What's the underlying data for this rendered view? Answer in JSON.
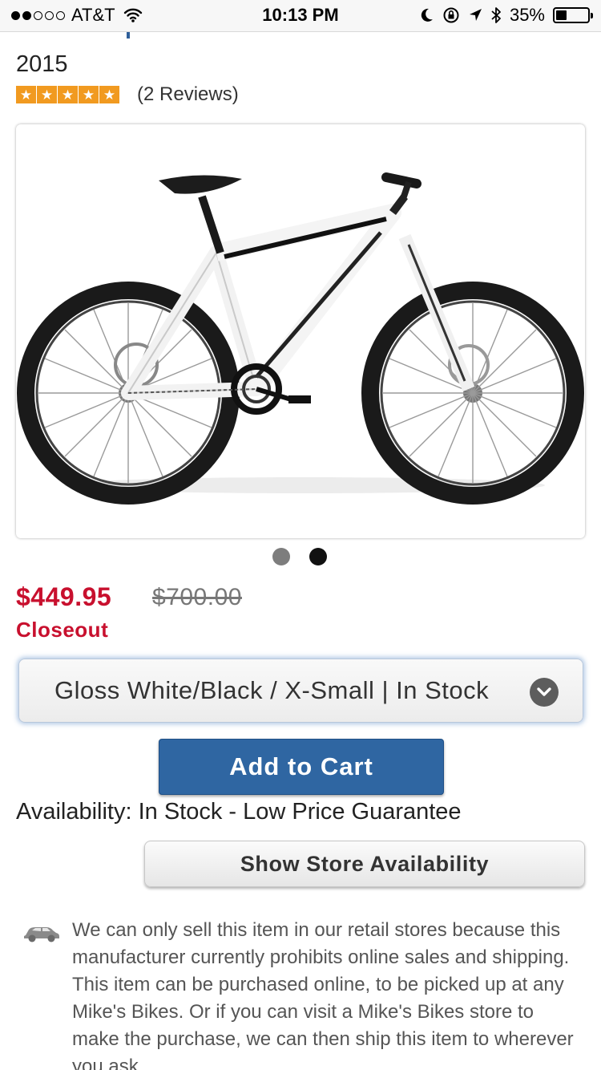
{
  "status_bar": {
    "carrier": "AT&T",
    "time": "10:13 PM",
    "battery": "35%",
    "battery_level": 0.35,
    "signal_bars_filled": 2,
    "signal_bars_total": 5
  },
  "product": {
    "title_tail": "2015",
    "rating": 5,
    "rating_max": 5,
    "reviews_label": "(2 Reviews)",
    "image_count": 2,
    "active_image_index": 1,
    "price": "$449.95",
    "original_price": "$700.00",
    "badge": "Closeout"
  },
  "variant_select": {
    "selected": "Gloss White/Black / X-Small | In Stock"
  },
  "actions": {
    "add_to_cart": "Add to Cart",
    "show_store_availability": "Show Store Availability"
  },
  "availability": "Availability: In Stock - Low Price Guarantee",
  "notice": "We can only sell this item in our retail stores because this manufacturer currently prohibits online sales and shipping. This item can be purchased online, to be picked up at any Mike's Bikes. Or if you can visit a Mike's Bikes store to make the purchase, we can then ship this item to wherever you ask.",
  "colors": {
    "price_red": "#c8102e",
    "button_blue": "#2f66a2",
    "star_orange": "#f19a20"
  }
}
